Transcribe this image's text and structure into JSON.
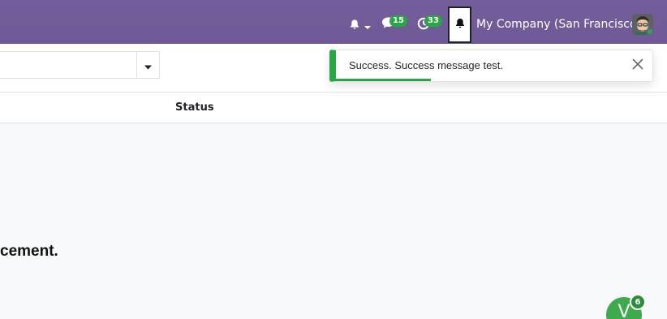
{
  "navbar": {
    "chat_badge": "15",
    "activity_badge": "33",
    "company": "My Company (San Francisco)"
  },
  "control_panel": {
    "search_value": ""
  },
  "list": {
    "status_header": "Status"
  },
  "helper_text": "cement.",
  "toast": {
    "message": "Success. Success message test.",
    "progress": 0.3
  },
  "fab": {
    "letter": "V",
    "badge": "6"
  },
  "colors": {
    "navbar": "#6f5a97",
    "success": "#28a745"
  },
  "icons": {
    "navbar": [
      "bell-icon",
      "caret-down-icon",
      "chat-icon",
      "clock-icon",
      "bell-icon"
    ],
    "toast": "close-icon",
    "search": "caret-down-icon"
  }
}
